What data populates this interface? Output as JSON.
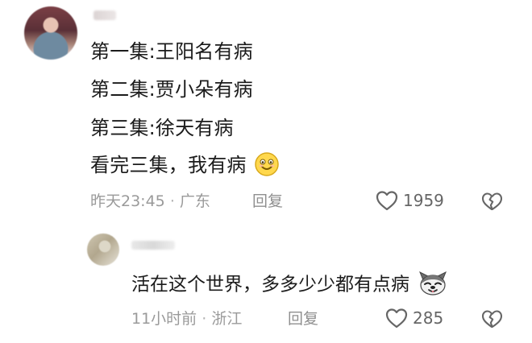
{
  "comments": {
    "main": {
      "lines": [
        "第一集:王阳名有病",
        "第二集:贾小朵有病",
        "第三集:徐天有病",
        "看完三集，我有病"
      ],
      "time": "昨天23:45",
      "separator": "·",
      "location": "广东",
      "reply_label": "回复",
      "like_count": "1959"
    },
    "reply": {
      "text": "活在这个世界，多多少少都有点病",
      "time": "11小时前",
      "separator": "·",
      "location": "浙江",
      "reply_label": "回复",
      "like_count": "285"
    }
  },
  "icons": {
    "like": "heart-outline-icon",
    "dislike": "broken-heart-icon",
    "main_emoji": "smile-emoji-icon",
    "reply_emoji": "dog-emoji-icon"
  },
  "colors": {
    "text": "#1b1b1b",
    "meta": "#9a9a9a",
    "icon": "#666666",
    "emoji_yellow": "#ffd84d"
  }
}
